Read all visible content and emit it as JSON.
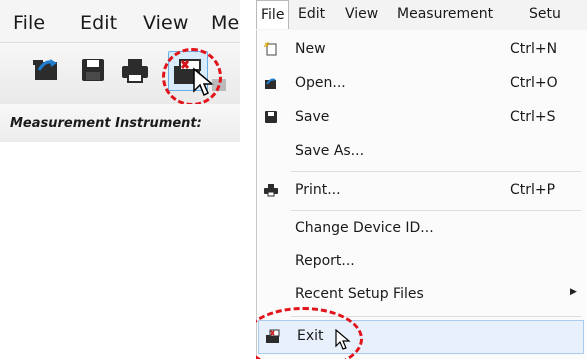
{
  "left": {
    "menubar": [
      "File",
      "Edit",
      "View",
      "Me"
    ],
    "toolbar_caption": "Measurement Instrument:"
  },
  "right": {
    "menubar": [
      "File",
      "Edit",
      "View",
      "Measurement",
      "Setu"
    ],
    "file_menu": [
      {
        "label": "New",
        "shortcut": "Ctrl+N",
        "icon": "new-icon"
      },
      {
        "label": "Open...",
        "shortcut": "Ctrl+O",
        "icon": "open-folder-icon"
      },
      {
        "label": "Save",
        "shortcut": "Ctrl+S",
        "icon": "save-icon"
      },
      {
        "label": "Save As...",
        "shortcut": "",
        "icon": ""
      },
      {
        "label": "Print...",
        "shortcut": "Ctrl+P",
        "icon": "print-icon"
      },
      {
        "label": "Change Device ID...",
        "shortcut": "",
        "icon": ""
      },
      {
        "label": "Report...",
        "shortcut": "",
        "icon": ""
      },
      {
        "label": "Recent Setup Files",
        "shortcut": "",
        "icon": "",
        "submenu": true
      },
      {
        "label": "Exit",
        "shortcut": "",
        "icon": "exit-icon",
        "highlighted": true
      }
    ]
  },
  "colors": {
    "highlight": "#e8f1fb",
    "annotation": "#e2141b"
  }
}
